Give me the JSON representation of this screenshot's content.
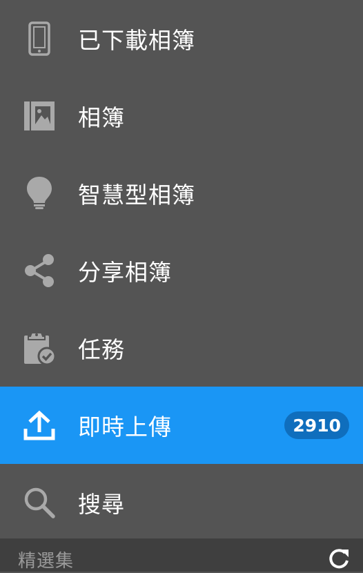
{
  "colors": {
    "background": "#545454",
    "active_background": "#1a96f5",
    "icon_gray": "#a9a9a9",
    "badge_background": "#0f6ebd",
    "footer_background": "#3f3f3f"
  },
  "menu": {
    "items": [
      {
        "label": "已下載相簿",
        "icon": "phone-icon"
      },
      {
        "label": "相簿",
        "icon": "album-icon"
      },
      {
        "label": "智慧型相簿",
        "icon": "lightbulb-icon"
      },
      {
        "label": "分享相簿",
        "icon": "share-icon"
      },
      {
        "label": "任務",
        "icon": "clipboard-check-icon"
      },
      {
        "label": "即時上傳",
        "icon": "upload-icon",
        "badge": "2910",
        "active": true
      },
      {
        "label": "搜尋",
        "icon": "search-icon"
      }
    ]
  },
  "footer": {
    "label": "精選集",
    "icon": "refresh-icon"
  }
}
